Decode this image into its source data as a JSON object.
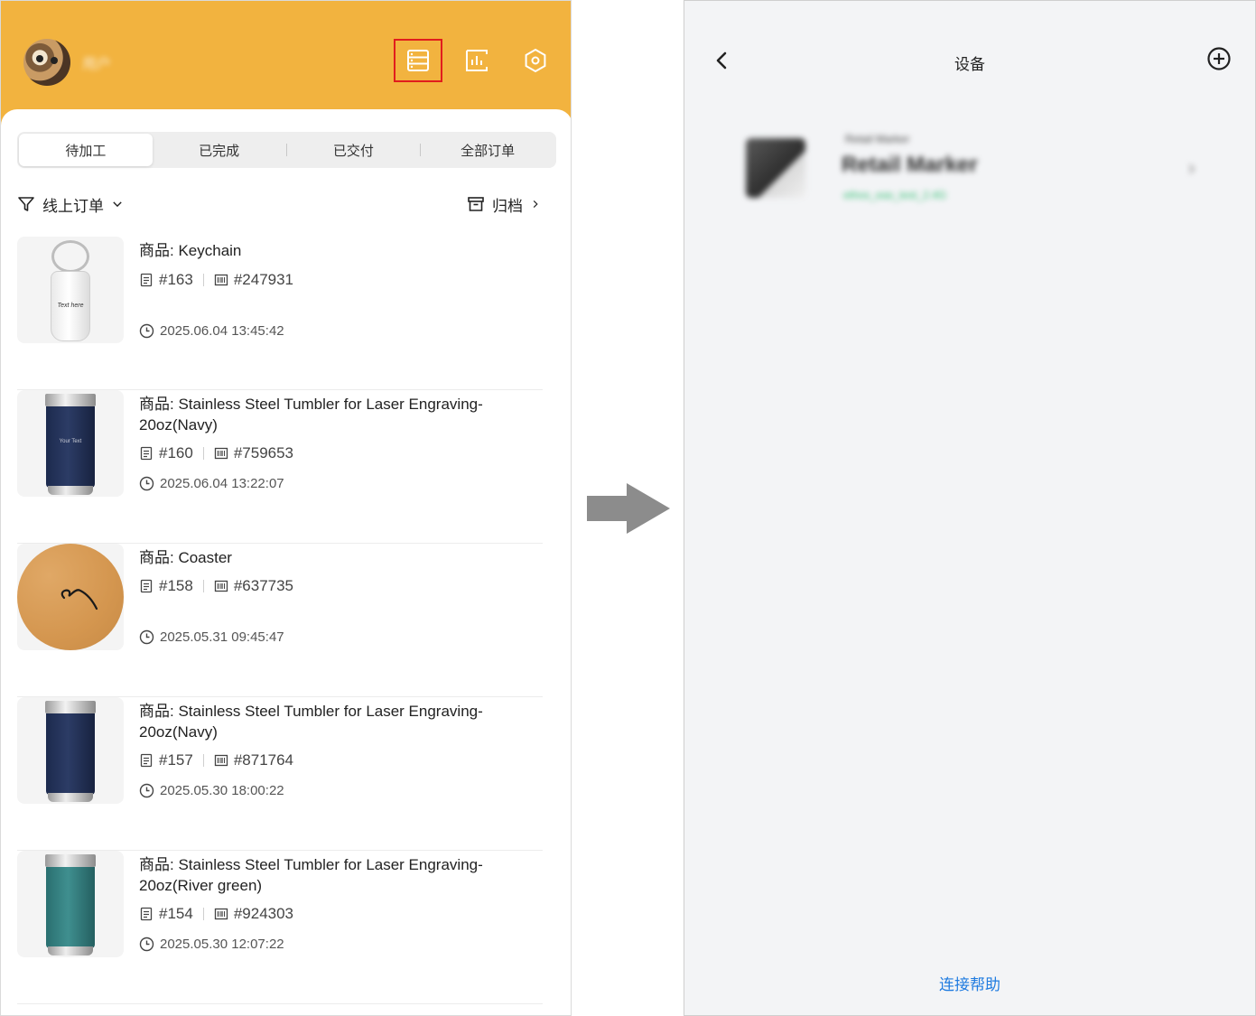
{
  "left": {
    "header": {
      "username": "用户",
      "icons": [
        "list-icon",
        "stats-icon",
        "settings-icon"
      ],
      "highlight_color": "#e11d1d",
      "bg_color": "#f2b33f"
    },
    "tabs": [
      "待加工",
      "已完成",
      "已交付",
      "全部订单"
    ],
    "filter": {
      "label": "线上订单",
      "archive": "归档"
    },
    "orders": [
      {
        "title": "商品: Keychain",
        "order_no": "#163",
        "code": "#247931",
        "time": "2025.06.04 13:45:42",
        "thumb": "keychain"
      },
      {
        "title": "商品: Stainless Steel Tumbler for Laser Engraving-20oz(Navy)",
        "order_no": "#160",
        "code": "#759653",
        "time": "2025.06.04 13:22:07",
        "thumb": "tumbler-navy"
      },
      {
        "title": "商品: Coaster",
        "order_no": "#158",
        "code": "#637735",
        "time": "2025.05.31 09:45:47",
        "thumb": "coaster"
      },
      {
        "title": "商品: Stainless Steel Tumbler for Laser Engraving-20oz(Navy)",
        "order_no": "#157",
        "code": "#871764",
        "time": "2025.05.30 18:00:22",
        "thumb": "tumbler-navy"
      },
      {
        "title": "商品: Stainless Steel Tumbler for Laser Engraving-20oz(River green)",
        "order_no": "#154",
        "code": "#924303",
        "time": "2025.05.30 12:07:22",
        "thumb": "tumbler-green"
      }
    ],
    "thumb_text": {
      "keychain": "Text here",
      "tumbler": "Your Text"
    }
  },
  "right": {
    "title": "设备",
    "device": {
      "subtitle": "Retail Marker",
      "name": "Retail Marker",
      "status": "ethos_eas_test_2.4G"
    },
    "help_link": "连接帮助",
    "link_color": "#1f7be0"
  }
}
